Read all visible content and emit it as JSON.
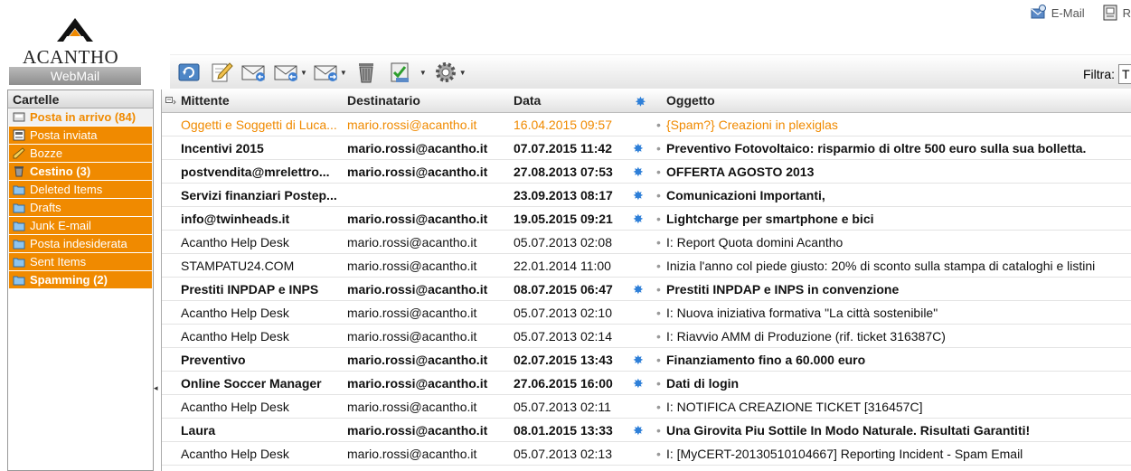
{
  "brand": {
    "name": "ACANTHO",
    "sub": "WebMail"
  },
  "toplinks": [
    {
      "label": "E-Mail"
    },
    {
      "label": "R"
    }
  ],
  "toolbar": {
    "buttons": [
      "refresh-icon",
      "compose-icon",
      "reply-icon",
      "reply-all-icon",
      "forward-icon",
      "delete-icon",
      "spam-icon",
      "settings-icon"
    ],
    "filter_label": "Filtra:",
    "filter_value": "T"
  },
  "sidebar": {
    "title": "Cartelle",
    "folders": [
      {
        "label": "Posta in arrivo (84)",
        "icon": "inbox-icon"
      },
      {
        "label": "Posta inviata",
        "icon": "sent-icon"
      },
      {
        "label": "Bozze",
        "icon": "drafts-icon"
      },
      {
        "label": "Cestino (3)",
        "icon": "trash-icon"
      },
      {
        "label": "Deleted Items",
        "icon": "folder-icon"
      },
      {
        "label": "Drafts",
        "icon": "folder-icon"
      },
      {
        "label": "Junk E-mail",
        "icon": "folder-icon"
      },
      {
        "label": "Posta indesiderata",
        "icon": "folder-icon"
      },
      {
        "label": "Sent Items",
        "icon": "folder-icon"
      },
      {
        "label": "Spamming (2)",
        "icon": "folder-icon"
      }
    ]
  },
  "list": {
    "columns": {
      "from": "Mittente",
      "to": "Destinatario",
      "date": "Data",
      "subject": "Oggetto"
    },
    "messages": [
      {
        "from": "Oggetti e Soggetti di Luca...",
        "to": "mario.rossi@acantho.it",
        "date": "16.04.2015 09:57",
        "subject": "{Spam?} Creazioni in plexiglas"
      },
      {
        "from": "Incentivi 2015",
        "to": "mario.rossi@acantho.it",
        "date": "07.07.2015 11:42",
        "subject": "Preventivo Fotovoltaico: risparmio di oltre 500 euro sulla sua bolletta."
      },
      {
        "from": "postvendita@mrelettro...",
        "to": "mario.rossi@acantho.it",
        "date": "27.08.2013 07:53",
        "subject": "OFFERTA AGOSTO 2013"
      },
      {
        "from": "Servizi finanziari Postep...",
        "to": "",
        "date": "23.09.2013 08:17",
        "subject": "Comunicazioni Importanti,"
      },
      {
        "from": "info@twinheads.it",
        "to": "mario.rossi@acantho.it",
        "date": "19.05.2015 09:21",
        "subject": "Lightcharge per smartphone e bici"
      },
      {
        "from": "Acantho Help Desk",
        "to": "mario.rossi@acantho.it",
        "date": "05.07.2013 02:08",
        "subject": "I: Report Quota domini Acantho"
      },
      {
        "from": "STAMPATU24.COM",
        "to": "mario.rossi@acantho.it",
        "date": "22.01.2014 11:00",
        "subject": "Inizia l'anno col piede giusto: 20% di sconto sulla stampa di cataloghi e listini"
      },
      {
        "from": "Prestiti INPDAP e INPS",
        "to": "mario.rossi@acantho.it",
        "date": "08.07.2015 06:47",
        "subject": "Prestiti INPDAP e INPS in convenzione"
      },
      {
        "from": "Acantho Help Desk",
        "to": "mario.rossi@acantho.it",
        "date": "05.07.2013 02:10",
        "subject": "I: Nuova iniziativa formativa \"La città sostenibile\""
      },
      {
        "from": "Acantho Help Desk",
        "to": "mario.rossi@acantho.it",
        "date": "05.07.2013 02:14",
        "subject": "I: Riavvio AMM di Produzione (rif. ticket 316387C)"
      },
      {
        "from": "Preventivo",
        "to": "mario.rossi@acantho.it",
        "date": "02.07.2015 13:43",
        "subject": "Finanziamento fino a 60.000 euro"
      },
      {
        "from": "Online Soccer Manager",
        "to": "mario.rossi@acantho.it",
        "date": "27.06.2015 16:00",
        "subject": "Dati di login"
      },
      {
        "from": "Acantho Help Desk",
        "to": "mario.rossi@acantho.it",
        "date": "05.07.2013 02:11",
        "subject": "I: NOTIFICA CREAZIONE TICKET [316457C]"
      },
      {
        "from": "Laura",
        "to": "mario.rossi@acantho.it",
        "date": "08.01.2015 13:33",
        "subject": "Una Girovita Piu Sottile In Modo Naturale. Risultati Garantiti!"
      },
      {
        "from": "Acantho Help Desk",
        "to": "mario.rossi@acantho.it",
        "date": "05.07.2013 02:13",
        "subject": "I: [MyCERT-20130510104667] Reporting Incident - Spam Email"
      }
    ]
  }
}
